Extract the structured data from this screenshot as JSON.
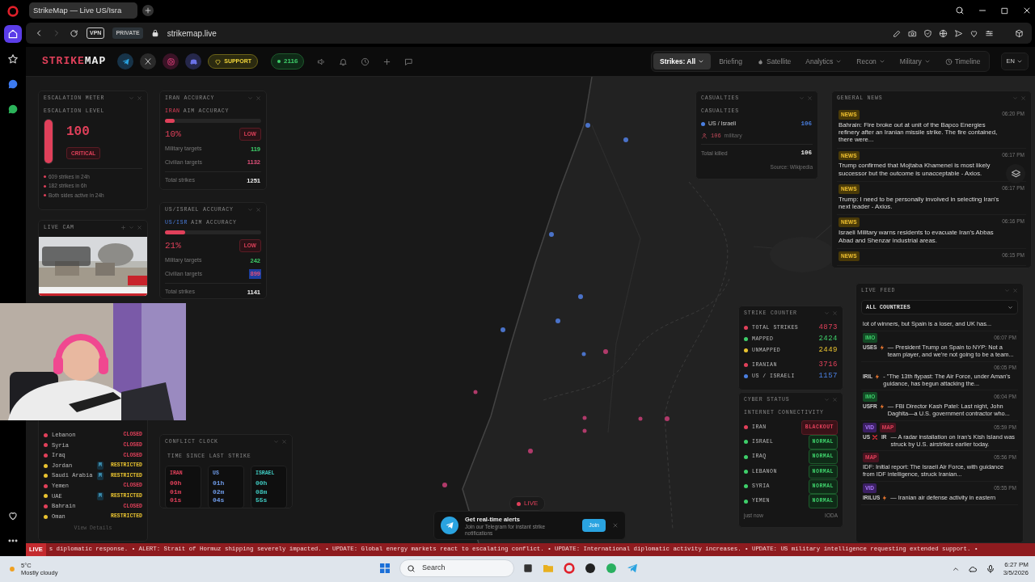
{
  "browser": {
    "tab_title": "StrikeMap — Live US/Isra",
    "vpn": "VPN",
    "private": "PRIVATE",
    "address": "strikemap.live",
    "sidebar": [
      {
        "selected": true
      },
      {
        "selected": false
      },
      {
        "selected": false
      },
      {
        "selected": false
      },
      {
        "selected": false
      },
      {
        "selected": false
      }
    ]
  },
  "header": {
    "logo": {
      "first": "STRIKE",
      "second": "MAP"
    },
    "support": "SUPPORT",
    "online_count": "2116",
    "nav": [
      {
        "label": "Strikes: All",
        "selected": true,
        "dropdown": true
      },
      {
        "label": "Briefing",
        "selected": false,
        "dropdown": false
      },
      {
        "label": "Satellite",
        "selected": false,
        "dropdown": false
      },
      {
        "label": "Analytics",
        "selected": false,
        "dropdown": true
      },
      {
        "label": "Recon",
        "selected": false,
        "dropdown": true
      },
      {
        "label": "Military",
        "selected": false,
        "dropdown": true
      },
      {
        "label": "Timeline",
        "selected": false,
        "dropdown": false
      }
    ],
    "language": "EN"
  },
  "panels": {
    "escalation": {
      "title": "ESCALATION METER",
      "subtitle": "ESCALATION LEVEL",
      "level": 1.0,
      "score": "100",
      "severity": "CRITICAL",
      "notes": [
        "609 strikes in 24h",
        "182 strikes in 6h",
        "Both sides active in 24h"
      ]
    },
    "live_cam": {
      "title": "LIVE CAM",
      "kind": "picture"
    },
    "accuracy": [
      {
        "title": "IRAN ACCURACY",
        "side": {
          "label": "IRAN",
          "kind": "iran"
        },
        "subtitle": "AIM ACCURACY",
        "level": 0.1,
        "percent": "10%",
        "rating": "LOW",
        "rows": [
          {
            "label": "Military targets",
            "value": "119",
            "kind": "military"
          },
          {
            "label": "Civilian targets",
            "value": "1132",
            "kind": "civilian"
          },
          {
            "label": "Total strikes",
            "value": "1251",
            "kind": "total"
          }
        ]
      },
      {
        "title": "US/ISRAEL ACCURACY",
        "side": {
          "label": "US/ISR",
          "kind": "us_israel"
        },
        "subtitle": "AIM ACCURACY",
        "level": 0.21,
        "percent": "21%",
        "rating": "LOW",
        "rows": [
          {
            "label": "Military targets",
            "value": "242",
            "kind": "military"
          },
          {
            "label": "Civilian targets",
            "value": "899",
            "kind": "civilian",
            "selected": true
          },
          {
            "label": "Total strikes",
            "value": "1141",
            "kind": "total"
          }
        ]
      }
    ],
    "airspace": {
      "rows": [
        {
          "name": "Lebanon",
          "color": "#e0405a",
          "kind": "closed",
          "status": "CLOSED"
        },
        {
          "name": "Syria",
          "color": "#e0405a",
          "kind": "closed",
          "status": "CLOSED"
        },
        {
          "name": "Iraq",
          "color": "#e0405a",
          "kind": "closed",
          "status": "CLOSED"
        },
        {
          "name": "Jordan",
          "color": "#e8c230",
          "kind": "restricted",
          "badge": "M",
          "status": "RESTRICTED"
        },
        {
          "name": "Saudi Arabia",
          "color": "#e8c230",
          "kind": "restricted",
          "badge": "M",
          "status": "RESTRICTED"
        },
        {
          "name": "Yemen",
          "color": "#e0405a",
          "kind": "closed",
          "status": "CLOSED"
        },
        {
          "name": "UAE",
          "color": "#e8c230",
          "kind": "restricted",
          "badge": "M",
          "status": "RESTRICTED"
        },
        {
          "name": "Bahrain",
          "color": "#e0405a",
          "kind": "closed",
          "status": "CLOSED"
        },
        {
          "name": "Oman",
          "color": "#e8c230",
          "kind": "restricted",
          "status": "RESTRICTED"
        }
      ],
      "link": "View Details"
    },
    "conflict_clock": {
      "title": "CONFLICT CLOCK",
      "subtitle": "TIME SINCE LAST STRIKE",
      "timers": [
        {
          "label": "IRAN",
          "time": "00h 01m 01s",
          "kind": "iran"
        },
        {
          "label": "US",
          "time": "01h 02m 04s",
          "kind": "us"
        },
        {
          "label": "ISRAEL",
          "time": "00h 08m 55s",
          "kind": "israel"
        }
      ]
    },
    "casualties": {
      "title": "CASUALTIES",
      "subtitle": "CASUALTIES",
      "side": {
        "label": "US / Israeli",
        "value": "106",
        "color": "#4a7fe0"
      },
      "military_count": "106",
      "military_label": "military",
      "total": {
        "label": "Total killed",
        "value": "106"
      },
      "source": "Source: Wikipedia"
    },
    "general_news": {
      "title": "GENERAL NEWS",
      "items": [
        {
          "tag": "NEWS",
          "time": "06:20 PM",
          "text": "Bahrain: Fire broke out at unit of the Bapco Energies refinery after an Iranian missile strike. The fire contained, there were..."
        },
        {
          "tag": "NEWS",
          "time": "06:17 PM",
          "text": "Trump confirmed that Mojtaba Khamenei is most likely successor but the outcome is unacceptable - Axios."
        },
        {
          "tag": "NEWS",
          "time": "06:17 PM",
          "text": "Trump: I need to be personally involved in selecting Iran's next leader - Axios."
        },
        {
          "tag": "NEWS",
          "time": "06:16 PM",
          "text": "Israeli Military warns residents to evacuate Iran's Abbas Abad and Shenzar industrial areas."
        },
        {
          "tag": "NEWS",
          "time": "06:15 PM"
        }
      ]
    },
    "strike_counter": {
      "title": "STRIKE COUNTER",
      "rows": [
        {
          "label": "TOTAL STRIKES",
          "value": "4873",
          "color": "#e0405a"
        },
        {
          "label": "MAPPED",
          "value": "2424",
          "color": "#3ecf6a"
        },
        {
          "label": "UNMAPPED",
          "value": "2449",
          "color": "#e8c230"
        },
        {
          "label": "IRANIAN",
          "value": "3716",
          "color": "#e0405a"
        },
        {
          "label": "US / ISRAELI",
          "value": "1157",
          "color": "#4a7fe0"
        }
      ]
    },
    "cyber_status": {
      "title": "CYBER STATUS",
      "subtitle": "INTERNET CONNECTIVITY",
      "rows": [
        {
          "name": "IRAN",
          "color": "#e0405a",
          "kind": "blackout",
          "status": "BLACKOUT"
        },
        {
          "name": "ISRAEL",
          "color": "#3ecf6a",
          "kind": "normal",
          "status": "NORMAL"
        },
        {
          "name": "IRAQ",
          "color": "#3ecf6a",
          "kind": "normal",
          "status": "NORMAL"
        },
        {
          "name": "LEBANON",
          "color": "#3ecf6a",
          "kind": "normal",
          "status": "NORMAL"
        },
        {
          "name": "SYRIA",
          "color": "#3ecf6a",
          "kind": "normal",
          "status": "NORMAL"
        },
        {
          "name": "YEMEN",
          "color": "#3ecf6a",
          "kind": "normal",
          "status": "NORMAL"
        }
      ],
      "updated": "just now",
      "source": "IODA"
    },
    "live_feed": {
      "title": "LIVE FEED",
      "filter": "ALL COUNTRIES",
      "items": [
        {
          "text": "lot of winners, but Spain is a loser, and UK has..."
        },
        {
          "tags": [
            {
              "label": "IMO",
              "kind": "imo"
            }
          ],
          "time": "06:07 PM",
          "source": "USES",
          "marker": {
            "kind": "bolt"
          },
          "text": "— President Trump on Spain to NYP: Not a team player, and we're not going to be a team..."
        },
        {
          "time": "06:05 PM",
          "source": "IRIL",
          "marker": {
            "kind": "bolt"
          },
          "text": "- \"The 13th flypast: The Air Force, under Aman's guidance, has begun attacking the..."
        },
        {
          "tags": [
            {
              "label": "IMO",
              "kind": "imo"
            }
          ],
          "time": "06:04 PM",
          "source": "USFR",
          "marker": {
            "kind": "bolt"
          },
          "text": "— FBI Director Kash Patel: Last night, John Daghita—a U.S. government contractor who..."
        },
        {
          "tags": [
            {
              "label": "VID",
              "kind": "vid"
            },
            {
              "label": "MAP",
              "kind": "map"
            }
          ],
          "time": "05:59 PM",
          "source": "US",
          "marker": {
            "kind": "cross"
          },
          "target": "IR",
          "text": "— A radar installation on Iran's Kish Island was struck by U.S. airstrikes earlier today."
        },
        {
          "tags": [
            {
              "label": "MAP",
              "kind": "map"
            }
          ],
          "time": "05:56 PM",
          "text": "IDF: Initial report: The Israeli Air Force, with guidance from IDF intelligence, struck Iranian..."
        },
        {
          "tags": [
            {
              "label": "VID",
              "kind": "vid"
            }
          ],
          "time": "05:55 PM",
          "source": "IRILUS",
          "marker": {
            "kind": "bolt"
          },
          "text": "— Iranian air defense activity in eastern"
        }
      ]
    }
  },
  "live_badge": "LIVE",
  "telegram_popup": {
    "title": "Get real-time alerts",
    "text": "Join our Telegram for instant strike notifications",
    "button": "Join"
  },
  "ticker": {
    "label": "LIVE",
    "text": "s diplomatic response. • ALERT: Strait of Hormuz shipping severely impacted. • UPDATE: Global energy markets react to escalating conflict. • UPDATE: International diplomatic activity increases. • UPDATE: US military intelligence requesting extended support. •"
  },
  "taskbar": {
    "temperature": "5°C",
    "weather": "Mostly cloudy",
    "search_placeholder": "Search",
    "time": "6:27 PM",
    "date": "3/5/2026"
  }
}
